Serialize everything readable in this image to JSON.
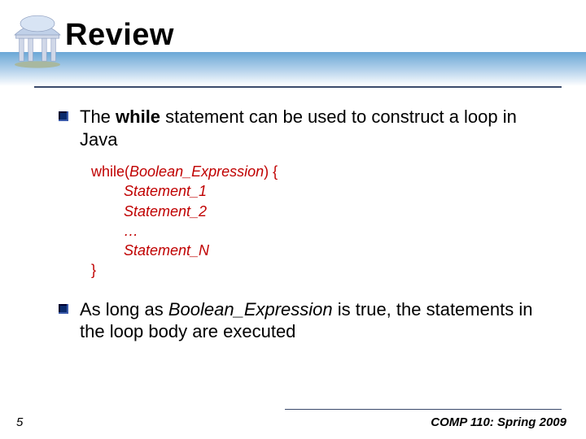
{
  "title": "Review",
  "bullets": {
    "b1_pre": "The ",
    "b1_bold": "while",
    "b1_post": " statement can be used to construct a loop in Java",
    "b2_pre": "As long as ",
    "b2_italic": "Boolean_Expression",
    "b2_post": " is true, the statements in the loop body are executed"
  },
  "code": {
    "kw": "while",
    "open": "(",
    "arg": "Boolean_Expression",
    "close_brace_open": ") {",
    "s1": "Statement_1",
    "s2": "Statement_2",
    "ellipsis": "…",
    "sn": "Statement_N",
    "brace_close": "}"
  },
  "footer": {
    "page": "5",
    "course": "COMP 110: Spring 2009"
  }
}
